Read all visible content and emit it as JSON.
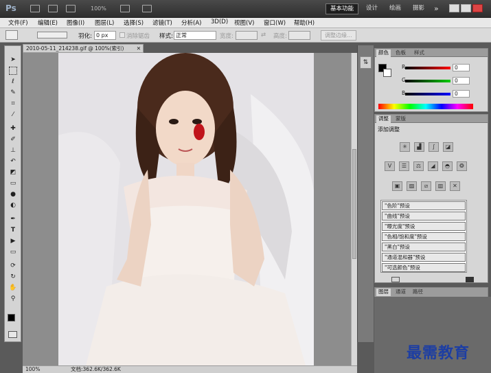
{
  "appbar": {
    "logo": "Ps",
    "zoom": "100%",
    "workspaces": [
      {
        "label": "基本功能",
        "active": true
      },
      {
        "label": "设计",
        "active": false
      },
      {
        "label": "绘画",
        "active": false
      },
      {
        "label": "摄影",
        "active": false
      }
    ],
    "more": "»"
  },
  "menu": [
    "文件(F)",
    "编辑(E)",
    "图像(I)",
    "图层(L)",
    "选择(S)",
    "滤镜(T)",
    "分析(A)",
    "3D(D)",
    "视图(V)",
    "窗口(W)",
    "帮助(H)"
  ],
  "options": {
    "feather_label": "羽化:",
    "feather_value": "0 px",
    "antialias_label": "消除锯齿",
    "style_label": "样式:",
    "style_value": "正常",
    "width_label": "宽度:",
    "height_label": "高度:",
    "refine_button": "调整边缘..."
  },
  "document": {
    "tab_title": "2010-05-11_214238.gif @ 100%(索引)",
    "zoom": "100%",
    "doc_info": "文档:362.6K/362.6K"
  },
  "color_panel": {
    "tabs": [
      "颜色",
      "色板",
      "样式"
    ],
    "r_label": "R",
    "r_value": "0",
    "g_label": "G",
    "g_value": "0",
    "b_label": "B",
    "b_value": "0"
  },
  "adjust_panel": {
    "tabs": [
      "调整",
      "蒙版"
    ],
    "title": "添加调整",
    "presets": [
      "\"色阶\"预设",
      "\"曲线\"预设",
      "\"曝光度\"预设",
      "\"色相/饱和度\"预设",
      "\"黑白\"预设",
      "\"通道混和器\"预设",
      "\"可选颜色\"预设"
    ]
  },
  "layers_panel": {
    "tabs": [
      "图层",
      "通道",
      "路径"
    ]
  },
  "watermark": "最需教育",
  "colors": {
    "accent": "#1d3ea3",
    "photo_bg": "#e4e2e6"
  }
}
